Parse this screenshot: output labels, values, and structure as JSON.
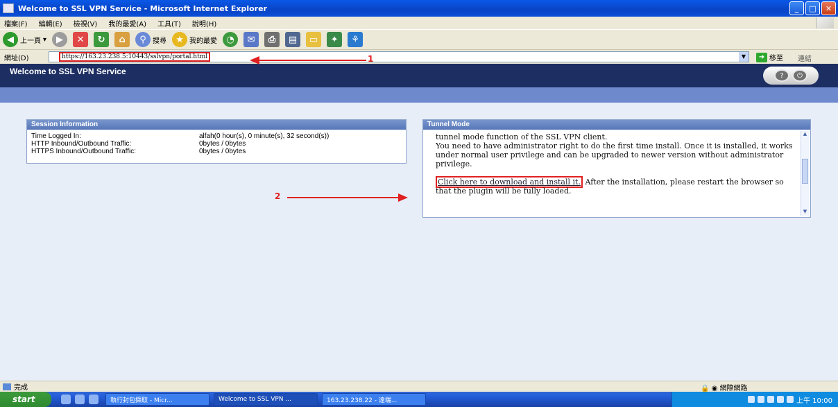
{
  "window": {
    "title": "Welcome to SSL VPN Service - Microsoft Internet Explorer",
    "minimize": "_",
    "maximize": "□",
    "close": "✕"
  },
  "menu": [
    "檔案(F)",
    "編輯(E)",
    "檢視(V)",
    "我的最愛(A)",
    "工具(T)",
    "說明(H)"
  ],
  "toolbar": {
    "back": "上一頁",
    "search": "搜尋",
    "favorites": "我的最愛"
  },
  "addressbar": {
    "label": "網址(D)",
    "url": "https://163.23.238.5:10443/sslvpn/portal.html",
    "go": "移至",
    "links": "連結"
  },
  "page": {
    "title": "Welcome to SSL VPN Service"
  },
  "session": {
    "heading": "Session Information",
    "rows": [
      {
        "label": "Time Logged In:",
        "value": "alfah(0 hour(s), 0 minute(s), 32 second(s))"
      },
      {
        "label": "HTTP Inbound/Outbound Traffic:",
        "value": "0bytes / 0bytes"
      },
      {
        "label": "HTTPS Inbound/Outbound Traffic:",
        "value": "0bytes / 0bytes"
      }
    ]
  },
  "tunnel": {
    "heading": "Tunnel Mode",
    "para1": "tunnel mode function of the SSL VPN client.",
    "para2": "You need to have administrator right to do the first time install. Once it is installed, it works under normal user privilege and can be upgraded to newer version without administrator privilege.",
    "link": "Click here to download and install it.",
    "para3": "After the installation, please restart the browser so that the plugin will be fully loaded."
  },
  "annotations": {
    "one": "1",
    "two": "2",
    "color": "#e02020"
  },
  "status": {
    "left": "完成",
    "zone": "網際網路"
  },
  "taskbar": {
    "start": "start",
    "tasks": [
      "執行封包擷取 - Micr...",
      "Welcome to SSL VPN ...",
      "163.23.238.22 - 遠端..."
    ],
    "clock": "上午 10:00"
  }
}
